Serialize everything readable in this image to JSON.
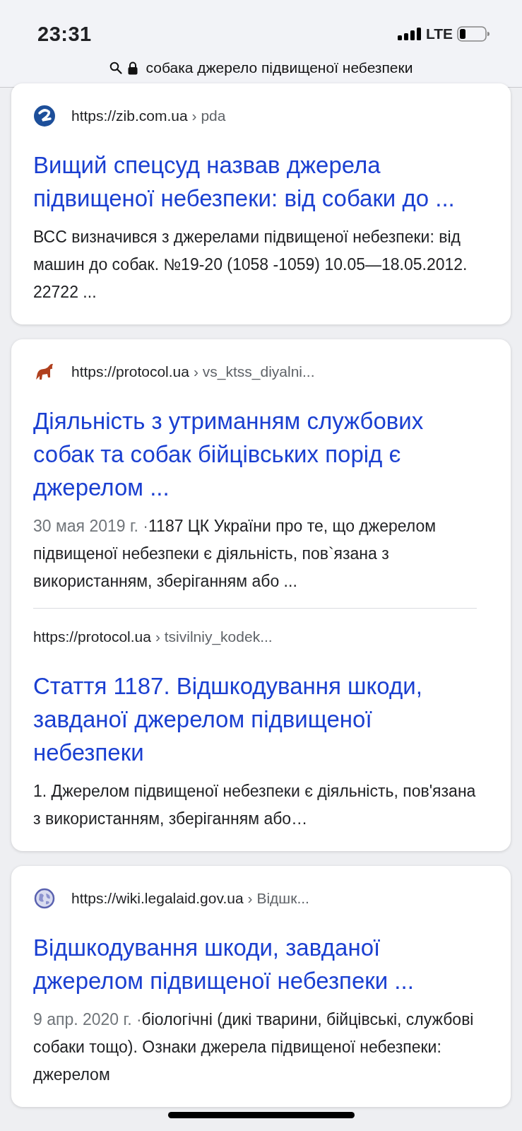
{
  "status_bar": {
    "time": "23:31",
    "network": "LTE"
  },
  "address_bar": {
    "query": "собака джерело підвищеної небезпеки"
  },
  "cards": [
    {
      "results": [
        {
          "kind": "zib",
          "site": "https://zib.com.ua",
          "path": "› pda",
          "title": "Вищий спецсуд назвав джерела підвищеної небезпеки: від собаки до ...",
          "snippet": "ВСС визначився з джерелами підвищеної небезпеки: від машин до собак. №19-20 (1058 -1059) 10.05—18.05.2012. 22722 ..."
        }
      ]
    },
    {
      "results": [
        {
          "kind": "elephant",
          "site": "https://protocol.ua",
          "path": "› vs_ktss_diyalni...",
          "title": "Діяльність з утриманням службових собак та собак бійцівських порід є джерелом ...",
          "date": "30 мая 2019 г. ·",
          "snippet": "1187 ЦК України про те, що джерелом підвищеної небезпеки є діяльність, пов`язана з використанням, зберіганням або ..."
        },
        {
          "site": "https://protocol.ua",
          "path": "› tsivilniy_kodek...",
          "title": "Стаття 1187. Відшкодування шкоди, завданої джерелом підвищеної небезпеки",
          "snippet": "1. Джерелом підвищеної небезпеки є діяльність, пов'язана з використанням, зберіганням або…"
        }
      ]
    },
    {
      "results": [
        {
          "kind": "globe",
          "site": "https://wiki.legalaid.gov.ua",
          "path": "› Відшк...",
          "title": "Відшкодування шкоди, завданої джерелом підвищеної небезпеки ...",
          "date": "9 апр. 2020 г. ·",
          "snippet": "біологічні (дикі тварини, бійцівські, службові собаки тощо). Ознаки джерела підвищеної небезпеки: джерелом"
        }
      ]
    }
  ]
}
